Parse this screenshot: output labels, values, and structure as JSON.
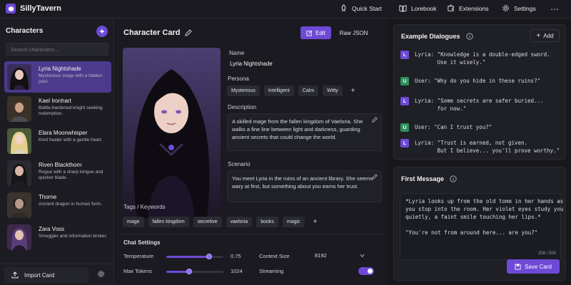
{
  "app": {
    "name": "SillyTavern"
  },
  "nav": {
    "quick_start": "Quick Start",
    "lorebook": "Lorebook",
    "extensions": "Extensions",
    "settings": "Settings"
  },
  "sidebar": {
    "title": "Characters",
    "search_placeholder": "Search characters...",
    "characters": [
      {
        "name": "Lyria Nightshade",
        "desc": "Mysterious mage with a hidden past."
      },
      {
        "name": "Kael Ironhart",
        "desc": "Battle-hardened knight seeking redemption."
      },
      {
        "name": "Elara Moonwhisper",
        "desc": "Kind healer with a gentle heart."
      },
      {
        "name": "Riven Blackthorn",
        "desc": "Rogue with a sharp tongue and quicker blade."
      },
      {
        "name": "Thorne",
        "desc": "Ancient dragon in human form."
      },
      {
        "name": "Zara Voss",
        "desc": "Smuggler and information broker."
      }
    ],
    "import_label": "Import Card"
  },
  "main": {
    "title": "Character Card",
    "tab_edit": "Edit",
    "tab_raw": "Raw JSON",
    "name_label": "Name",
    "name_value": "Lyria Nightshade",
    "persona_label": "Persona",
    "persona_tags": [
      "Mysterious",
      "Intelligent",
      "Calm",
      "Witty"
    ],
    "description_label": "Description",
    "description": "A skilled mage from the fallen kingdom of Vaeloria. She walks a fine line between light and darkness, guarding ancient secrets that could change the world.",
    "scenario_label": "Scenario",
    "scenario": "You meet Lyria in the ruins of an ancient library. She seems wary at first, but something about you earns her trust.",
    "tags_label": "Tags / Keywords",
    "tags": [
      "mage",
      "fallen kingdom",
      "secretive",
      "vaeloria",
      "books",
      "magic"
    ],
    "chat_settings_label": "Chat Settings",
    "temperature_label": "Temperature",
    "temperature_value": "0.75",
    "temperature_level": 0.75,
    "max_tokens_label": "Max Tokens",
    "max_tokens_value": "1024",
    "max_tokens_level": 0.4,
    "context_size_label": "Context Size",
    "context_size_value": "8192",
    "streaming_label": "Streaming",
    "streaming_on": true
  },
  "dialogues": {
    "title": "Example Dialogues",
    "add_label": "Add",
    "items": [
      {
        "role": "L",
        "text": "Lyria: \"Knowledge is a double-edged sword.\n       Use it wisely.\""
      },
      {
        "role": "U",
        "text": "User: \"Why do you hide in these ruins?\""
      },
      {
        "role": "L",
        "text": "Lyria: \"Some secrets are safer buried...\n       for now.\""
      },
      {
        "role": "U",
        "text": "User: \"Can I trust you?\""
      },
      {
        "role": "L",
        "text": "Lyria: \"Trust is earned, not given.\n       But I believe... you'll prove worthy.\""
      }
    ]
  },
  "first_message": {
    "title": "First Message",
    "text": "*Lyria looks up from the old tome in her hands as\nyou stop into the room. Her violet eyes study you\nquietly, a faint smile touching her lips.*\n\n\"You're not from around here... are you?\"",
    "counter": "208 / 500"
  },
  "save_label": "Save Card",
  "colors": {
    "accent": "#6d4ad6",
    "user_badge": "#2f8f5b",
    "bg": "#17171c"
  }
}
